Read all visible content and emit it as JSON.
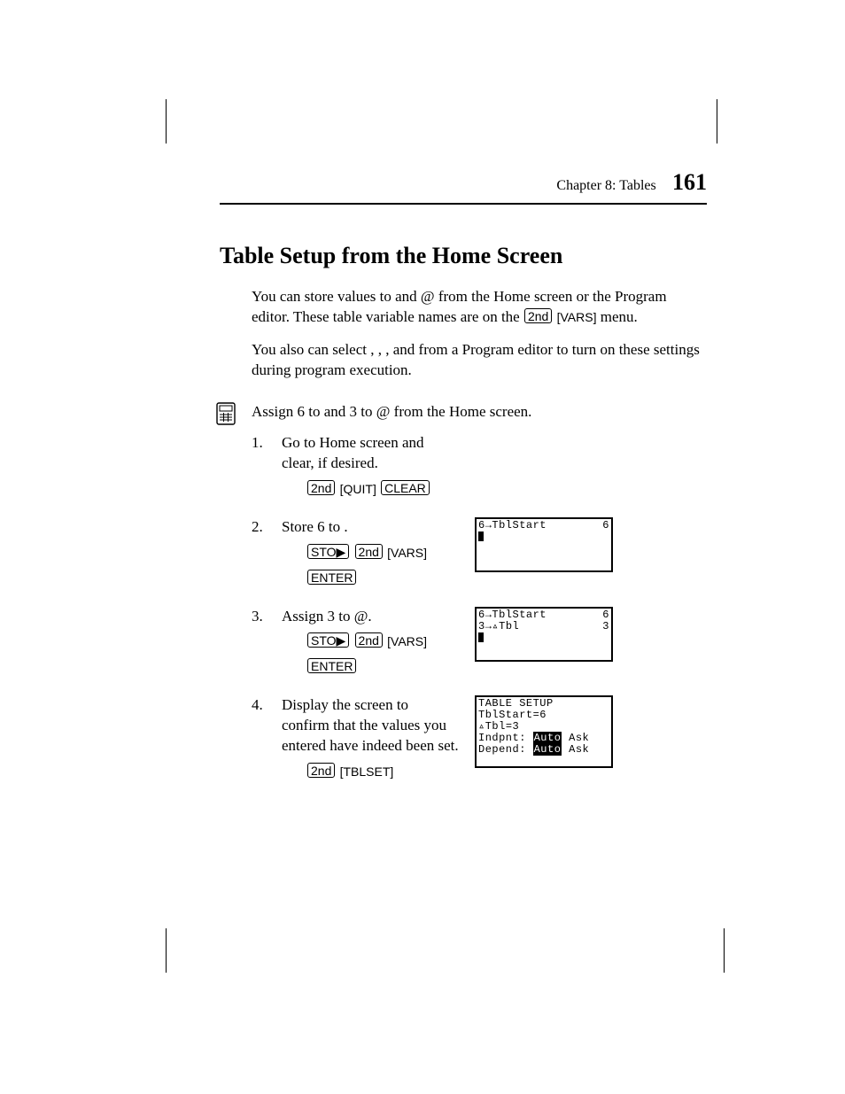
{
  "runhead": {
    "chapter": "Chapter 8: Tables",
    "page": "161"
  },
  "heading": "Table Setup from the Home Screen",
  "para1_a": "You can store values to ",
  "para1_b": " and ",
  "para1_delta": "@",
  "para1_c": " from the Home screen or the Program editor. These table variable names are on the ",
  "para1_key2nd": "2nd",
  "para1_vars": "[VARS]",
  "para1_d": " menu.",
  "para2_a": "You also can select ",
  "para2_b": ", ",
  "para2_c": ", ",
  "para2_d": ", and ",
  "para2_e": " from a Program editor to turn on these settings during program execution.",
  "intro_a": "Assign 6 to ",
  "intro_b": " and 3 to ",
  "intro_delta": "@",
  "intro_c": " from the Home screen.",
  "steps": [
    {
      "n": "1.",
      "text": "Go to Home screen and clear, if desired.",
      "keys": [
        "2nd",
        "[QUIT]",
        "CLEAR"
      ]
    },
    {
      "n": "2.",
      "text_a": "Store 6 to ",
      "text_b": ".",
      "keys1": [
        "STO▶",
        "2nd",
        "[VARS]"
      ],
      "keys2": [
        "ENTER"
      ]
    },
    {
      "n": "3.",
      "text_a": "Assign 3 to ",
      "delta": "@",
      "text_b": ".",
      "keys1": [
        "STO▶",
        "2nd",
        "[VARS]"
      ],
      "keys2": [
        "ENTER"
      ]
    },
    {
      "n": "4.",
      "text": "Display the screen to confirm that the values you entered have indeed been set.",
      "keys": [
        "2nd",
        "[TBLSET]"
      ]
    }
  ],
  "lcd2": {
    "l1": "6→TblStart",
    "r1": "6"
  },
  "lcd3": {
    "l1": "6→TblStart",
    "r1": "6",
    "l2": "3→▵Tbl",
    "r2": "3"
  },
  "lcd4": {
    "l1": "TABLE SETUP",
    "l2": " TblStart=6",
    "l3": " ▵Tbl=3",
    "l4": "Indpnt: ",
    "l4auto": "Auto",
    "l4ask": " Ask",
    "l5": "Depend: ",
    "l5auto": "Auto",
    "l5ask": " Ask"
  }
}
